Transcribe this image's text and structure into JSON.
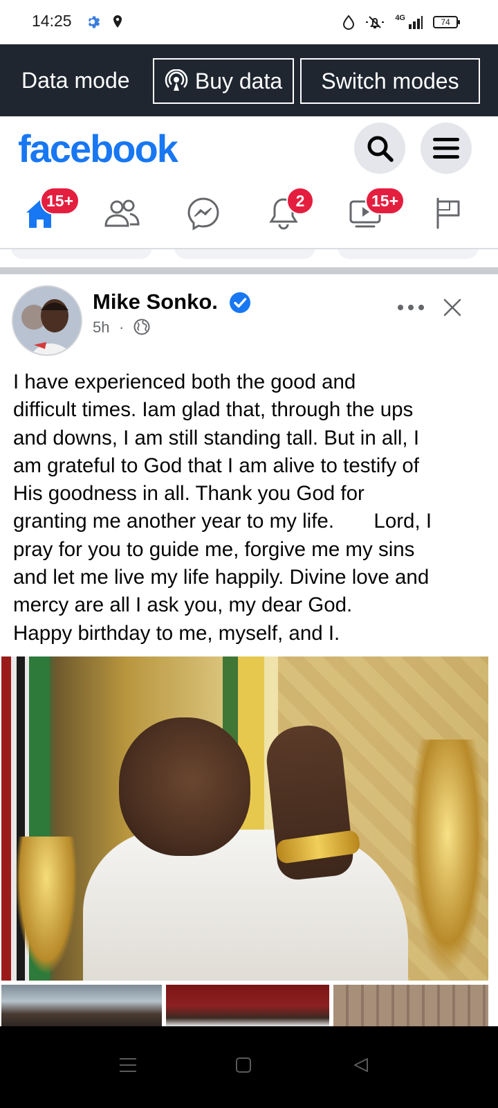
{
  "status_bar": {
    "time": "14:25",
    "network": "4G",
    "battery": "74"
  },
  "data_banner": {
    "mode_label": "Data mode",
    "buy_label": "Buy data",
    "switch_label": "Switch modes"
  },
  "header": {
    "logo": "facebook"
  },
  "nav": {
    "tabs": [
      {
        "name": "home",
        "badge": "15+"
      },
      {
        "name": "friends",
        "badge": ""
      },
      {
        "name": "messenger",
        "badge": ""
      },
      {
        "name": "notifications",
        "badge": "2"
      },
      {
        "name": "watch",
        "badge": "15+"
      },
      {
        "name": "pages",
        "badge": ""
      }
    ]
  },
  "post": {
    "author": "Mike Sonko.",
    "time": "5h",
    "separator": "·",
    "text": "I have experienced both the good and\ndifficult times. Iam glad that, through the ups\nand downs, I am still standing tall. But in all, I\nam grateful to God that I am alive to testify of\nHis goodness in all. Thank you God for\ngranting me another year to my life.       Lord, I\npray for you to guide me, forgive me my sins\nand let me live my life happily. Divine love and\nmercy are all I ask you, my dear God.\nHappy birthday to me, myself, and I."
  },
  "colors": {
    "facebook_blue": "#1877f2",
    "badge_red": "#e41e3f",
    "banner_bg": "#1f2630",
    "verified_blue": "#1877f2"
  },
  "icons": {
    "status": [
      "gear-icon",
      "location-icon",
      "drop-icon",
      "bell-mute-icon",
      "signal-icon",
      "battery-icon"
    ],
    "nav": [
      "home-icon",
      "friends-icon",
      "messenger-icon",
      "bell-icon",
      "watch-icon",
      "flag-icon"
    ],
    "system": [
      "menu-icon",
      "home-square-icon",
      "back-triangle-icon"
    ]
  }
}
